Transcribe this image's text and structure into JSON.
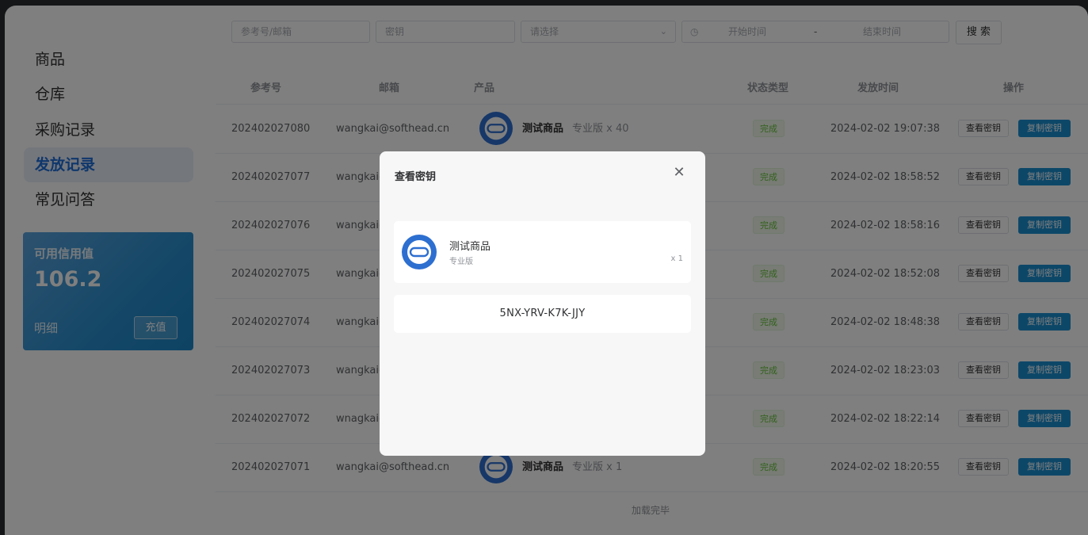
{
  "sidebar": {
    "items": [
      {
        "label": "商品",
        "active": false
      },
      {
        "label": "仓库",
        "active": false
      },
      {
        "label": "采购记录",
        "active": false
      },
      {
        "label": "发放记录",
        "active": true
      },
      {
        "label": "常见问答",
        "active": false
      }
    ],
    "credit": {
      "label": "可用信用值",
      "value": "106.2",
      "detail": "明细",
      "recharge": "充值"
    }
  },
  "filters": {
    "ref_placeholder": "参考号/邮箱",
    "key_placeholder": "密钥",
    "select_placeholder": "请选择",
    "start_placeholder": "开始时间",
    "range_sep": "-",
    "end_placeholder": "结束时间",
    "search": "搜 索"
  },
  "table": {
    "headers": [
      "参考号",
      "邮箱",
      "产品",
      "状态类型",
      "发放时间",
      "操作"
    ],
    "rows": [
      {
        "ref": "202402027080",
        "email": "wangkai@softhead.cn",
        "product": "测试商品",
        "edition": "专业版 x 40",
        "status": "完成",
        "time": "2024-02-02 19:07:38"
      },
      {
        "ref": "202402027077",
        "email": "wangkai@",
        "product": "",
        "edition": "",
        "status": "完成",
        "time": "2024-02-02 18:58:52"
      },
      {
        "ref": "202402027076",
        "email": "wangkai@",
        "product": "",
        "edition": "",
        "status": "完成",
        "time": "2024-02-02 18:58:16"
      },
      {
        "ref": "202402027075",
        "email": "wangkai@",
        "product": "",
        "edition": "",
        "status": "完成",
        "time": "2024-02-02 18:52:08"
      },
      {
        "ref": "202402027074",
        "email": "wangkai@",
        "product": "",
        "edition": "",
        "status": "完成",
        "time": "2024-02-02 18:48:38"
      },
      {
        "ref": "202402027073",
        "email": "wangkai@",
        "product": "",
        "edition": "",
        "status": "完成",
        "time": "2024-02-02 18:23:03"
      },
      {
        "ref": "202402027072",
        "email": "wnagkai@",
        "product": "",
        "edition": "",
        "status": "完成",
        "time": "2024-02-02 18:22:14"
      },
      {
        "ref": "202402027071",
        "email": "wangkai@softhead.cn",
        "product": "测试商品",
        "edition": "专业版 x 1",
        "status": "完成",
        "time": "2024-02-02 18:20:55"
      }
    ],
    "view_label": "查看密钥",
    "copy_label": "复制密钥",
    "footer": "加载完毕"
  },
  "dialog": {
    "title": "查看密钥",
    "product": "测试商品",
    "edition": "专业版",
    "qty": "x 1",
    "key": "5NX-YRV-K7K-JJY"
  },
  "colors": {
    "accent": "#1a8fd0",
    "active_nav": "#1e6fd9",
    "success": "#67c23a",
    "mask": "rgba(0,0,0,0.5)"
  }
}
